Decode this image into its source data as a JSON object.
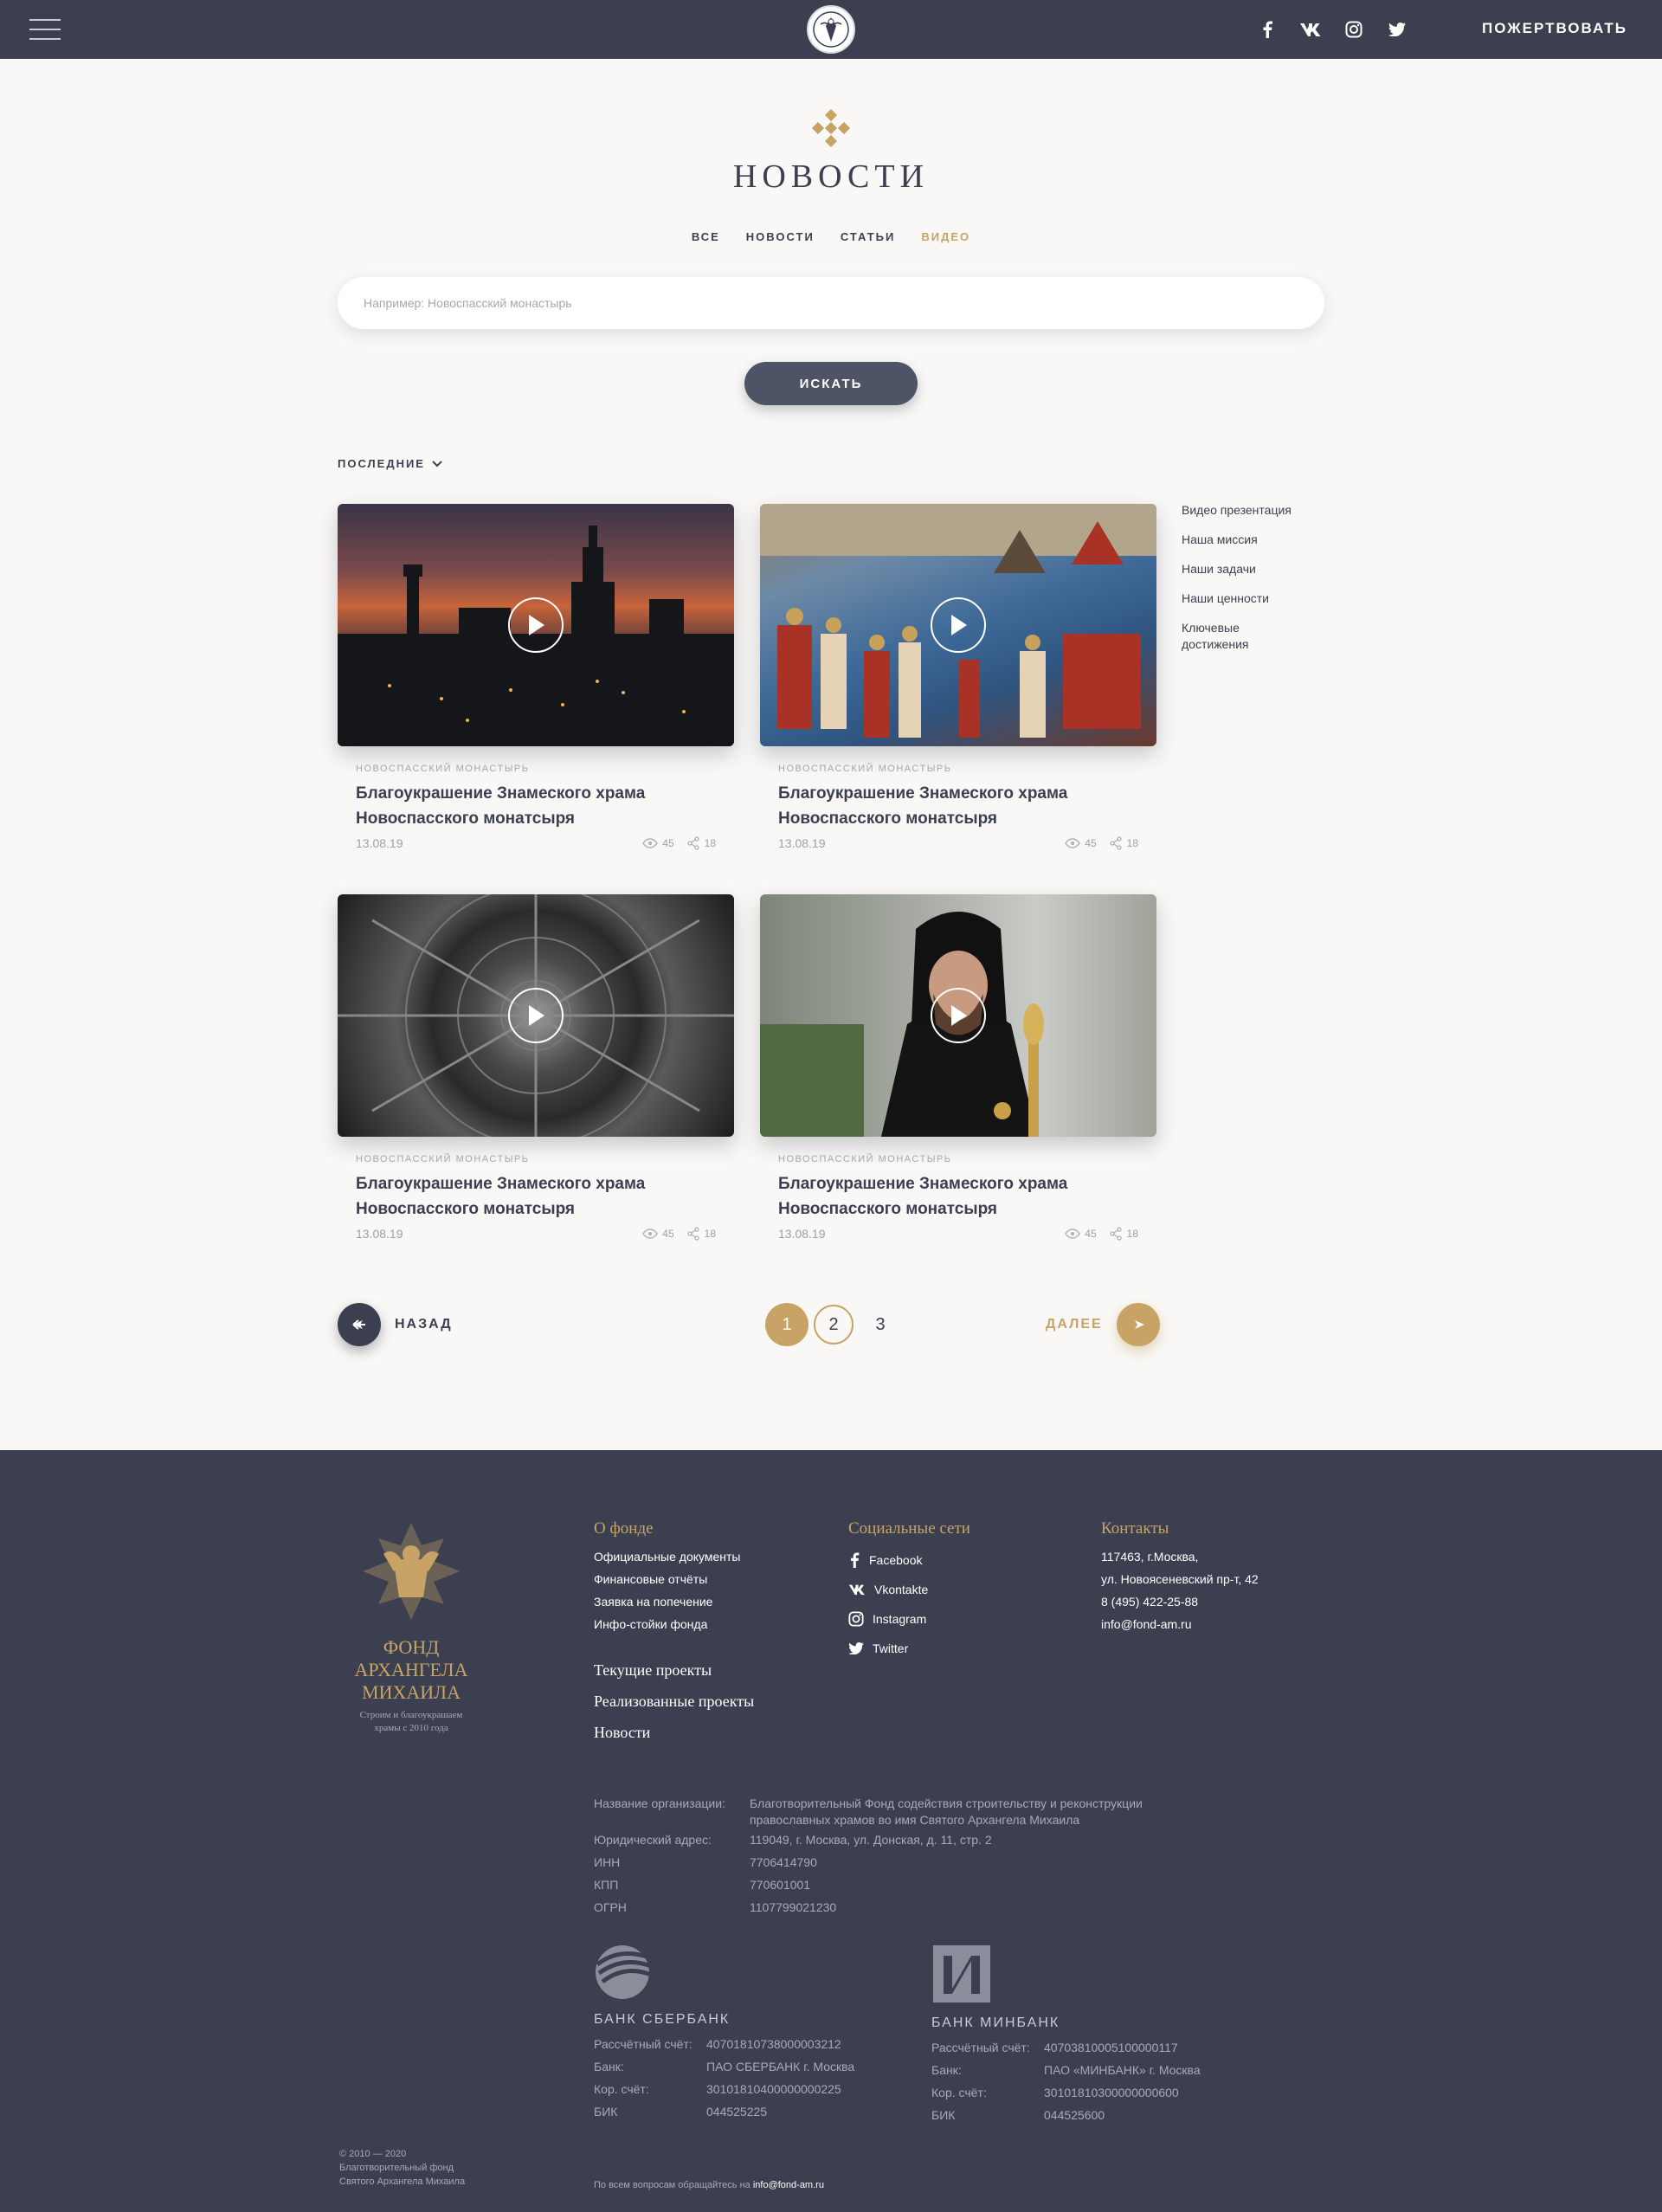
{
  "header": {
    "donate_label": "ПОЖЕРТВОВАТЬ"
  },
  "page": {
    "title": "НОВОСТИ",
    "filters": [
      {
        "label": "ВСЕ",
        "active": false
      },
      {
        "label": "НОВОСТИ",
        "active": false
      },
      {
        "label": "СТАТЬИ",
        "active": false
      },
      {
        "label": "ВИДЕО",
        "active": true
      }
    ],
    "search_placeholder": "Например: Новоспасский монастырь",
    "search_button": "ИСКАТЬ",
    "sort_label": "ПОСЛЕДНИЕ"
  },
  "cards": [
    {
      "category": "НОВОСПАССКИЙ МОНАСТЫРЬ",
      "title": "Благоукрашение Знамеского храма Новоспасского монатсыря",
      "date": "13.08.19",
      "views": "45",
      "shares": "18"
    },
    {
      "category": "НОВОСПАССКИЙ МОНАСТЫРЬ",
      "title": "Благоукрашение Знамеского храма Новоспасского монатсыря",
      "date": "13.08.19",
      "views": "45",
      "shares": "18"
    },
    {
      "category": "НОВОСПАССКИЙ МОНАСТЫРЬ",
      "title": "Благоукрашение Знамеского храма Новоспасского монатсыря",
      "date": "13.08.19",
      "views": "45",
      "shares": "18"
    },
    {
      "category": "НОВОСПАССКИЙ МОНАСТЫРЬ",
      "title": "Благоукрашение Знамеского храма Новоспасского монатсыря",
      "date": "13.08.19",
      "views": "45",
      "shares": "18"
    }
  ],
  "sidenav": [
    "Видео презентация",
    "Наша миссия",
    "Наши задачи",
    "Наши ценности",
    "Ключевые достижения"
  ],
  "pagination": {
    "back_label": "НАЗАД",
    "next_label": "ДАЛЕЕ",
    "pages": [
      "1",
      "2",
      "3"
    ],
    "current": "1"
  },
  "footer": {
    "brand": "ФОНД АРХАНГЕЛА МИХАИЛА",
    "tagline": "Строим и благоукрашаем храмы с 2010 года",
    "about": {
      "heading": "О фонде",
      "links": [
        "Официальные документы",
        "Финансовые отчёты",
        "Заявка на попечение",
        "Инфо-стойки фонда"
      ],
      "big_links": [
        "Текущие проекты",
        "Реализованные проекты",
        "Новости"
      ]
    },
    "social": {
      "heading": "Социальные сети",
      "items": [
        "Facebook",
        "Vkontakte",
        "Instagram",
        "Twitter"
      ]
    },
    "contacts": {
      "heading": "Контакты",
      "lines": [
        "117463, г.Москва,",
        "ул. Новоясеневский пр-т, 42",
        "8 (495) 422-25-88",
        "info@fond-am.ru"
      ]
    },
    "legal": [
      {
        "key": "Название организации:",
        "value": "Благотворительный Фонд содействия строительству и реконструкции православных храмов во имя Святого Архангела Михаила"
      },
      {
        "key": "Юридический адрес:",
        "value": "119049, г. Москва, ул. Донская, д. 11, стр. 2"
      },
      {
        "key": "ИНН",
        "value": "7706414790"
      },
      {
        "key": "КПП",
        "value": "770601001"
      },
      {
        "key": "ОГРН",
        "value": "1107799021230"
      }
    ],
    "banks": [
      {
        "name": "БАНК СБЕРБАНК",
        "rows": [
          {
            "key": "Рассчётный счёт:",
            "value": "40701810738000003212"
          },
          {
            "key": "Банк:",
            "value": "ПАО СБЕРБАНК г. Москва"
          },
          {
            "key": "Кор. счёт:",
            "value": "30101810400000000225"
          },
          {
            "key": "БИК",
            "value": "044525225"
          }
        ]
      },
      {
        "name": "БАНК МИНБАНК",
        "rows": [
          {
            "key": "Рассчётный счёт:",
            "value": "40703810005100000117"
          },
          {
            "key": "Банк:",
            "value": "ПАО «МИНБАНК» г. Москва"
          },
          {
            "key": "Кор. счёт:",
            "value": "30101810300000000600"
          },
          {
            "key": "БИК",
            "value": "044525600"
          }
        ]
      }
    ],
    "copyright": [
      "© 2010 — 2020",
      "Благотворительный фонд",
      "Святого Архангела Михаила"
    ],
    "contact_line_prefix": "По всем вопросам обращайтесь на",
    "contact_line_email": "info@fond-am.ru"
  },
  "colors": {
    "accent": "#c7a466",
    "dark": "#3b3f4f",
    "background": "#f9f8f6"
  }
}
